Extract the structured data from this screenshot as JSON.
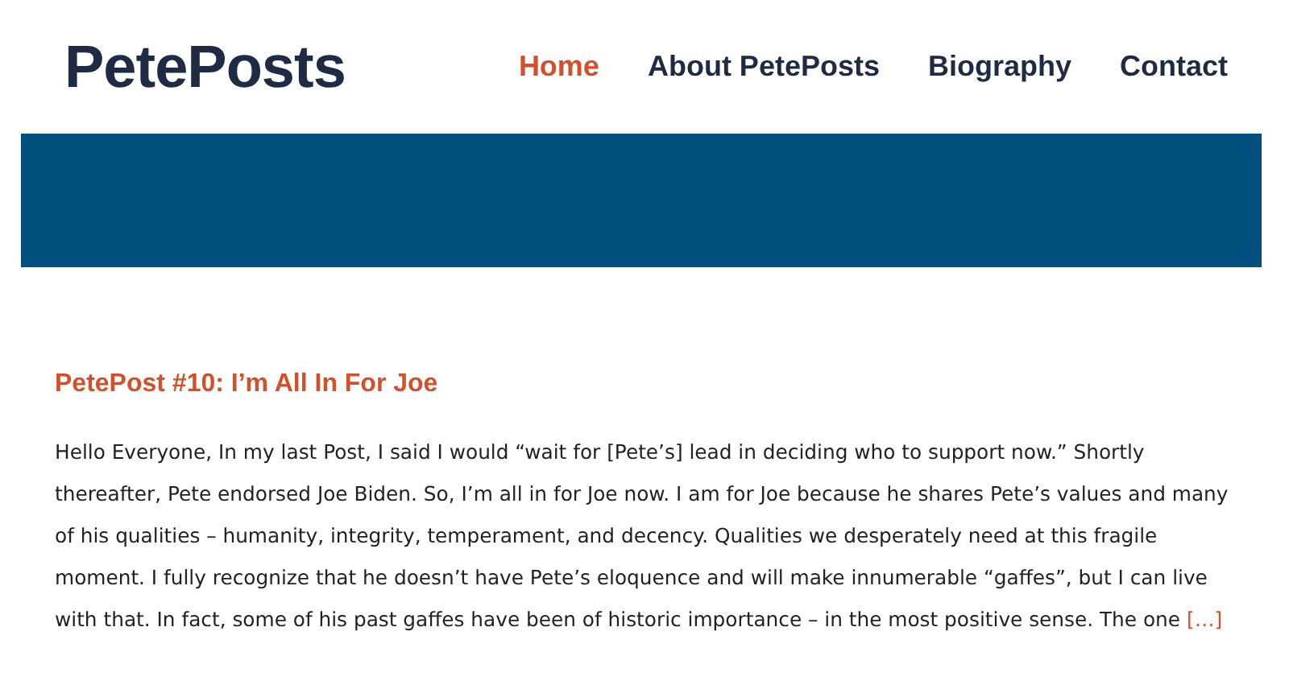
{
  "site": {
    "logo": "PetePosts"
  },
  "nav": [
    {
      "label": "Home",
      "selected": true
    },
    {
      "label": "About PetePosts",
      "selected": false
    },
    {
      "label": "Biography",
      "selected": false
    },
    {
      "label": "Contact",
      "selected": false
    }
  ],
  "post": {
    "title": "PetePost #10: I’m All In For Joe",
    "excerpt": "Hello Everyone, In my last Post, I said I would “wait for [Pete’s] lead in deciding who to support now.” Shortly thereafter, Pete endorsed Joe Biden. So, I’m all in for Joe now. I am for Joe because he shares Pete’s values and many of his qualities – humanity, integrity, temperament, and decency. Qualities we desperately need at this fragile moment. I fully recognize that he doesn’t have Pete’s eloquence and will make innumerable “gaffes”, but I can live with that. In fact, some of his past gaffes have been of historic importance – in the most positive sense. The one",
    "more_link": "[…]"
  }
}
